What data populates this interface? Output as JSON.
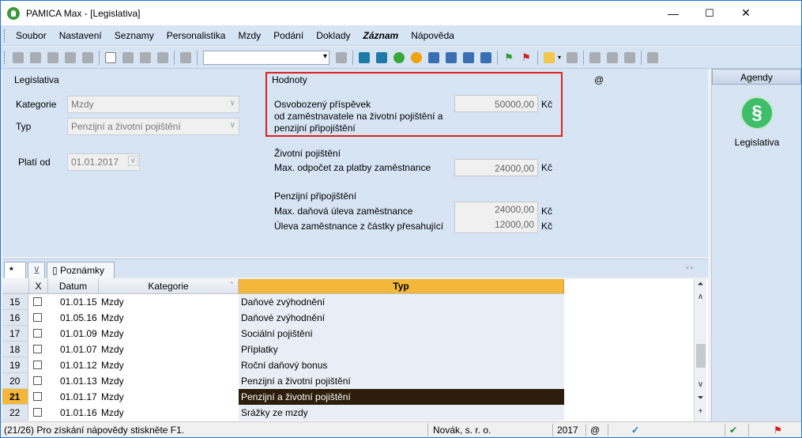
{
  "window": {
    "title": "PAMICA Max - [Legislativa]",
    "minimize": "—",
    "maximize": "☐",
    "close": "✕"
  },
  "menu": [
    "Soubor",
    "Nastavení",
    "Seznamy",
    "Personalistika",
    "Mzdy",
    "Podání",
    "Doklady",
    "Záznam",
    "Nápověda"
  ],
  "form": {
    "section_title": "Legislativa",
    "kategorie_label": "Kategorie",
    "kategorie_value": "Mzdy",
    "typ_label": "Typ",
    "typ_value": "Penzijní a životní pojištění",
    "plati_od_label": "Platí od",
    "plati_od_value": "01.01.2017"
  },
  "hodnoty": {
    "title": "Hodnoty",
    "at_sign": "@",
    "osvobozeny_line1": "Osvobozený příspěvek",
    "osvobozeny_line2": "od zaměstnavatele na životní pojištění a",
    "osvobozeny_line3": "penzijní připojištění",
    "osvobozeny_value": "50000,00",
    "currency": "Kč",
    "zivotni_title": "Životní pojištění",
    "zivotni_label": "Max. odpočet za platby zaměstnance",
    "zivotni_value": "24000,00",
    "penzijni_title": "Penzijní připojištění",
    "penzijni_label1": "Max. daňová úleva zaměstnance",
    "penzijni_value1": "24000,00",
    "penzijni_label2": "Úleva zaměstnance z částky přesahující",
    "penzijni_value2": "12000,00"
  },
  "agendy": {
    "header": "Agendy",
    "item_label": "Legislativa",
    "item_icon": "§"
  },
  "tabs": {
    "star": "*",
    "notes": "Poznámky"
  },
  "grid": {
    "columns": [
      "X",
      "Datum",
      "Kategorie",
      "Typ"
    ],
    "rows": [
      {
        "num": "15",
        "datum": "01.01.15",
        "kategorie": "Mzdy",
        "typ": "Daňové zvýhodnění"
      },
      {
        "num": "16",
        "datum": "01.05.16",
        "kategorie": "Mzdy",
        "typ": "Daňové zvýhodnění"
      },
      {
        "num": "17",
        "datum": "01.01.09",
        "kategorie": "Mzdy",
        "typ": "Sociální pojištění"
      },
      {
        "num": "18",
        "datum": "01.01.07",
        "kategorie": "Mzdy",
        "typ": "Příplatky"
      },
      {
        "num": "19",
        "datum": "01.01.12",
        "kategorie": "Mzdy",
        "typ": "Roční daňový bonus"
      },
      {
        "num": "20",
        "datum": "01.01.13",
        "kategorie": "Mzdy",
        "typ": "Penzijní a životní pojištění"
      },
      {
        "num": "21",
        "datum": "01.01.17",
        "kategorie": "Mzdy",
        "typ": "Penzijní a životní pojištění"
      },
      {
        "num": "22",
        "datum": "01.01.16",
        "kategorie": "Mzdy",
        "typ": "Srážky ze mzdy"
      }
    ],
    "selected_row": "21"
  },
  "status": {
    "left": "(21/26) Pro získání nápovědy stiskněte F1.",
    "company": "Novák, s. r. o.",
    "year": "2017",
    "at": "@"
  },
  "colors": {
    "accent": "#f4b73a",
    "panel": "#d6e4f4",
    "highlight": "#e02020",
    "selected_row": "#2c1e0a"
  }
}
